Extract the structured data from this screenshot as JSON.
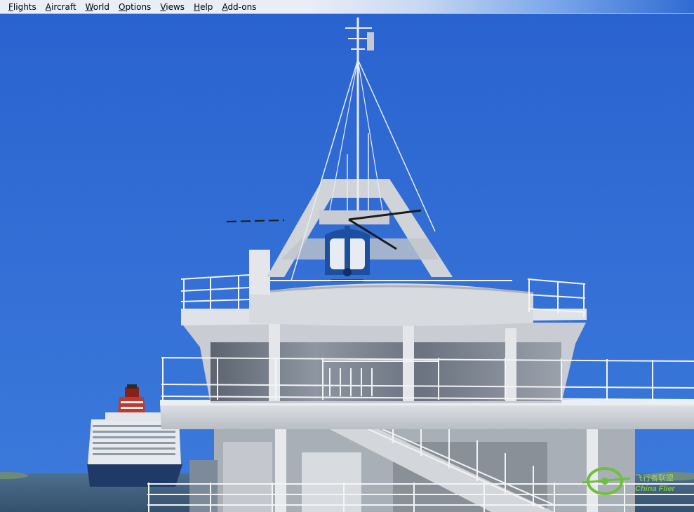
{
  "menubar": {
    "items": [
      {
        "label": "Flights",
        "accel": "F"
      },
      {
        "label": "Aircraft",
        "accel": "A"
      },
      {
        "label": "World",
        "accel": "W"
      },
      {
        "label": "Options",
        "accel": "O"
      },
      {
        "label": "Views",
        "accel": "V"
      },
      {
        "label": "Help",
        "accel": "H"
      },
      {
        "label": "Add-ons",
        "accel": "A"
      }
    ]
  },
  "scene": {
    "sky_color": "#2f6bd3",
    "sea_color": "#3d5a78",
    "helicopter_color": "#1d4fa0"
  },
  "watermark": {
    "text_cn": "飞行者联盟",
    "text_en": "China Flier"
  }
}
